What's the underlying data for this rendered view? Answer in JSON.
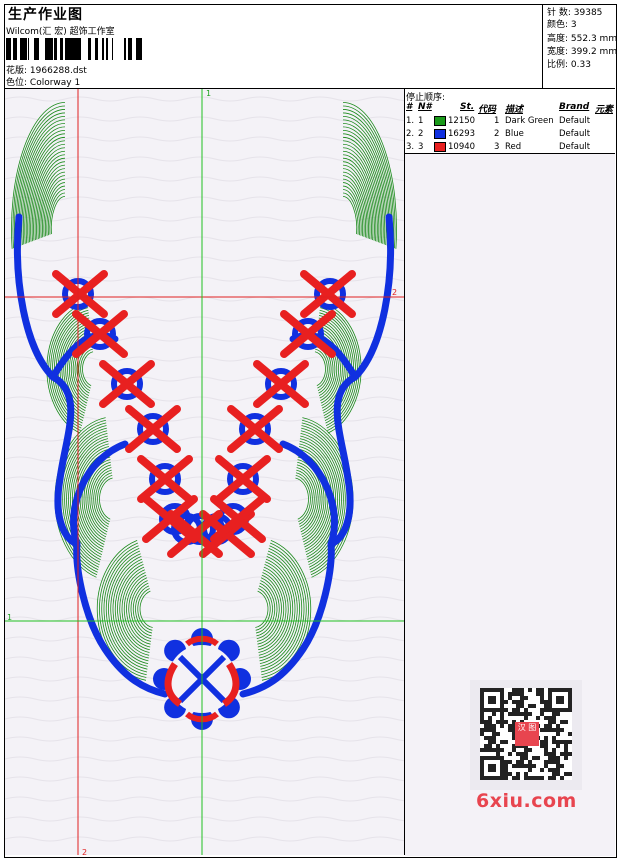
{
  "header": {
    "title": "生产作业图",
    "studio": "Wilcom(汇 宏) 超饰工作室",
    "design_label": "花版:",
    "design_value": "1966288.dst",
    "colorway_label": "色位:",
    "colorway_value": "Colorway 1"
  },
  "stats": [
    {
      "label": "针 数:",
      "value": "39385"
    },
    {
      "label": "颜色:",
      "value": "3"
    },
    {
      "label": "高度:",
      "value": "552.3 mm"
    },
    {
      "label": "宽度:",
      "value": "399.2 mm"
    },
    {
      "label": "比例:",
      "value": "0.33"
    }
  ],
  "color_sequence": {
    "label": "停止顺序:",
    "columns": [
      "#",
      "N#",
      "St.",
      "代码",
      "描述",
      "Brand",
      "元素"
    ],
    "rows": [
      {
        "num": "1.",
        "n": "1",
        "stitches": "12150",
        "code": "1",
        "desc": "Dark Green",
        "brand": "Default",
        "color": "#1a9a1a"
      },
      {
        "num": "2.",
        "n": "2",
        "stitches": "16293",
        "code": "2",
        "desc": "Blue",
        "brand": "Default",
        "color": "#1030e0"
      },
      {
        "num": "3.",
        "n": "3",
        "stitches": "10940",
        "code": "3",
        "desc": "Red",
        "brand": "Default",
        "color": "#e82020"
      }
    ]
  },
  "canvas": {
    "guide_labels": {
      "top": "1",
      "left": "1",
      "bottom": "2",
      "right": "2"
    },
    "colors": {
      "green": "#1a8a1a",
      "blue": "#1030e0",
      "red": "#e82020",
      "guide_red": "#e02020",
      "guide_green": "#20c020"
    }
  },
  "watermark": {
    "text": "6xiu.com",
    "stamp": "汉 图"
  }
}
